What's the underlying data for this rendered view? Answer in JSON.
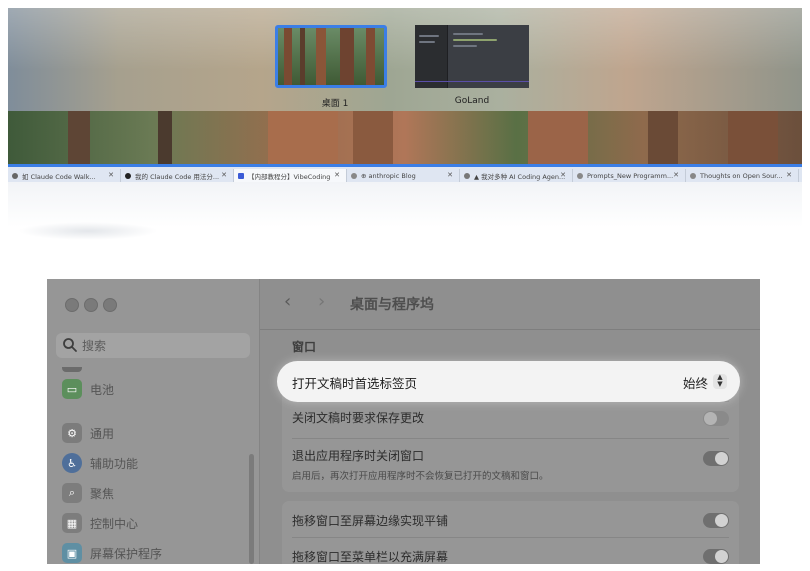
{
  "mission_control": {
    "spaces": [
      {
        "label": "桌面 1"
      },
      {
        "label": "GoLand"
      }
    ]
  },
  "browser_tabs": [
    {
      "label": "如 Claude Code Walk..."
    },
    {
      "label": "我的 Claude Code 用法分..."
    },
    {
      "label": "【内部教程分】VibeCoding"
    },
    {
      "label": "⊕ anthropic Blog"
    },
    {
      "label": "▲ 我对多种 AI Coding Agen..."
    },
    {
      "label": "Prompts_New Programm..."
    },
    {
      "label": "Thoughts on Open Sour..."
    }
  ],
  "settings": {
    "search_placeholder": "搜索",
    "page_title": "桌面与程序坞",
    "sidebar": [
      {
        "label": "电池",
        "icon": "battery-icon",
        "color": "#4aa14a"
      },
      {
        "label": "通用",
        "icon": "gear-icon",
        "color": "#8a8a8a"
      },
      {
        "label": "辅助功能",
        "icon": "accessibility-icon",
        "color": "#2f6fd1"
      },
      {
        "label": "聚焦",
        "icon": "magnifier-icon",
        "color": "#8a8a8a"
      },
      {
        "label": "控制中心",
        "icon": "control-center-icon",
        "color": "#8a8a8a"
      },
      {
        "label": "屏幕保护程序",
        "icon": "screensaver-icon",
        "color": "#4fa7c9"
      }
    ],
    "section_title": "窗口",
    "rows": {
      "prefer_tabs": {
        "label": "打开文稿时首选标签页",
        "value": "始终"
      },
      "ask_keep_changes": {
        "label": "关闭文稿时要求保存更改",
        "on": false
      },
      "close_windows": {
        "label": "退出应用程序时关闭窗口",
        "subtitle": "启用后，再次打开应用程序时不会恢复已打开的文稿和窗口。",
        "on": true
      },
      "tile_edges": {
        "label": "拖移窗口至屏幕边缘实现平铺",
        "on": true
      },
      "fill_menubar": {
        "label": "拖移窗口至菜单栏以充满屏幕",
        "on": true
      }
    }
  }
}
